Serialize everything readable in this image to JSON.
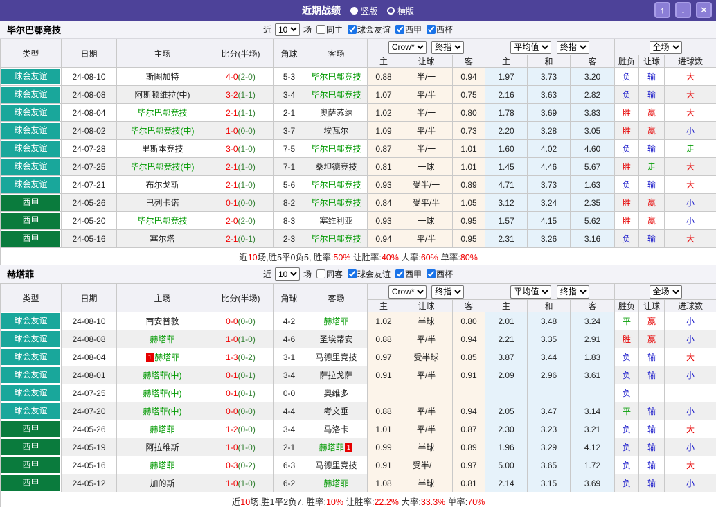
{
  "titlebar": {
    "title": "近期战绩",
    "radios": [
      {
        "label": "竖版",
        "selected": true
      },
      {
        "label": "横版",
        "selected": false
      }
    ],
    "buttons": {
      "up": "↑",
      "down": "↓",
      "close": "✕"
    }
  },
  "filter": {
    "prefix": "近",
    "matches": "10",
    "suffix": "场",
    "same_checked": false,
    "leagues": [
      "球会友谊",
      "西甲",
      "西杯"
    ],
    "leagues_checked": [
      true,
      true,
      true
    ]
  },
  "columns": [
    "类型",
    "日期",
    "主场",
    "比分(半场)",
    "角球",
    "客场"
  ],
  "subcolumns": [
    "主",
    "让球",
    "客",
    "主",
    "和",
    "客",
    "胜负",
    "让球",
    "进球数"
  ],
  "dropdowns": {
    "company": "Crow*",
    "company_stage": "终指",
    "avg": "平均值",
    "avg_stage": "终指",
    "scope": "全场"
  },
  "league_colors": {
    "球会友谊": "#19a79b",
    "西甲": "#0a7b3d"
  },
  "result_colors": {
    "胜": "#e60000",
    "赢": "#e60000",
    "大": "#e60000",
    "负": "#2222cc",
    "输": "#2222cc",
    "小": "#2222cc",
    "平": "#089e08",
    "走": "#089e08"
  },
  "sections": [
    {
      "team": "毕尔巴鄂竞技",
      "same_label": "同主",
      "rows": [
        {
          "league": "球会友谊",
          "date": "24-08-10",
          "home": {
            "name": "斯图加特",
            "green": false
          },
          "score": {
            "ft": "4-0",
            "ht": "(2-0)"
          },
          "corner": "5-3",
          "away": {
            "name": "毕尔巴鄂竞技",
            "green": true
          },
          "asian": [
            "0.88",
            "半/一",
            "0.94"
          ],
          "europe": [
            "1.97",
            "3.73",
            "3.20"
          ],
          "results": [
            "负",
            "输",
            "大"
          ]
        },
        {
          "league": "球会友谊",
          "date": "24-08-08",
          "home": {
            "name": "阿斯顿维拉(中)",
            "green": false
          },
          "score": {
            "ft": "3-2",
            "ht": "(1-1)"
          },
          "corner": "3-4",
          "away": {
            "name": "毕尔巴鄂竞技",
            "green": true
          },
          "asian": [
            "1.07",
            "平/半",
            "0.75"
          ],
          "europe": [
            "2.16",
            "3.63",
            "2.82"
          ],
          "results": [
            "负",
            "输",
            "大"
          ]
        },
        {
          "league": "球会友谊",
          "date": "24-08-04",
          "home": {
            "name": "毕尔巴鄂竞技",
            "green": true
          },
          "score": {
            "ft": "2-1",
            "ht": "(1-1)"
          },
          "corner": "2-1",
          "away": {
            "name": "奥萨苏纳",
            "green": false
          },
          "asian": [
            "1.02",
            "半/一",
            "0.80"
          ],
          "europe": [
            "1.78",
            "3.69",
            "3.83"
          ],
          "results": [
            "胜",
            "赢",
            "大"
          ]
        },
        {
          "league": "球会友谊",
          "date": "24-08-02",
          "home": {
            "name": "毕尔巴鄂竞技(中)",
            "green": true
          },
          "score": {
            "ft": "1-0",
            "ht": "(0-0)"
          },
          "corner": "3-7",
          "away": {
            "name": "埃瓦尔",
            "green": false
          },
          "asian": [
            "1.09",
            "平/半",
            "0.73"
          ],
          "europe": [
            "2.20",
            "3.28",
            "3.05"
          ],
          "results": [
            "胜",
            "赢",
            "小"
          ]
        },
        {
          "league": "球会友谊",
          "date": "24-07-28",
          "home": {
            "name": "里斯本竞技",
            "green": false
          },
          "score": {
            "ft": "3-0",
            "ht": "(1-0)"
          },
          "corner": "7-5",
          "away": {
            "name": "毕尔巴鄂竞技",
            "green": true
          },
          "asian": [
            "0.87",
            "半/一",
            "1.01"
          ],
          "europe": [
            "1.60",
            "4.02",
            "4.60"
          ],
          "results": [
            "负",
            "输",
            "走"
          ]
        },
        {
          "league": "球会友谊",
          "date": "24-07-25",
          "home": {
            "name": "毕尔巴鄂竞技(中)",
            "green": true
          },
          "score": {
            "ft": "2-1",
            "ht": "(1-0)"
          },
          "corner": "7-1",
          "away": {
            "name": "桑坦德竞技",
            "green": false
          },
          "asian": [
            "0.81",
            "一球",
            "1.01"
          ],
          "europe": [
            "1.45",
            "4.46",
            "5.67"
          ],
          "results": [
            "胜",
            "走",
            "大"
          ]
        },
        {
          "league": "球会友谊",
          "date": "24-07-21",
          "home": {
            "name": "布尔戈斯",
            "green": false
          },
          "score": {
            "ft": "2-1",
            "ht": "(1-0)"
          },
          "corner": "5-6",
          "away": {
            "name": "毕尔巴鄂竞技",
            "green": true
          },
          "asian": [
            "0.93",
            "受半/一",
            "0.89"
          ],
          "europe": [
            "4.71",
            "3.73",
            "1.63"
          ],
          "results": [
            "负",
            "输",
            "大"
          ]
        },
        {
          "league": "西甲",
          "date": "24-05-26",
          "home": {
            "name": "巴列卡诺",
            "green": false
          },
          "score": {
            "ft": "0-1",
            "ht": "(0-0)"
          },
          "corner": "8-2",
          "away": {
            "name": "毕尔巴鄂竞技",
            "green": true
          },
          "asian": [
            "0.84",
            "受平/半",
            "1.05"
          ],
          "europe": [
            "3.12",
            "3.24",
            "2.35"
          ],
          "results": [
            "胜",
            "赢",
            "小"
          ]
        },
        {
          "league": "西甲",
          "date": "24-05-20",
          "home": {
            "name": "毕尔巴鄂竞技",
            "green": true
          },
          "score": {
            "ft": "2-0",
            "ht": "(2-0)"
          },
          "corner": "8-3",
          "away": {
            "name": "塞维利亚",
            "green": false
          },
          "asian": [
            "0.93",
            "一球",
            "0.95"
          ],
          "europe": [
            "1.57",
            "4.15",
            "5.62"
          ],
          "results": [
            "胜",
            "赢",
            "小"
          ]
        },
        {
          "league": "西甲",
          "date": "24-05-16",
          "home": {
            "name": "塞尔塔",
            "green": false
          },
          "score": {
            "ft": "2-1",
            "ht": "(0-1)"
          },
          "corner": "2-3",
          "away": {
            "name": "毕尔巴鄂竞技",
            "green": true
          },
          "asian": [
            "0.94",
            "平/半",
            "0.95"
          ],
          "europe": [
            "2.31",
            "3.26",
            "3.16"
          ],
          "results": [
            "负",
            "输",
            "大"
          ]
        }
      ],
      "summary": [
        [
          "近",
          0
        ],
        [
          "10",
          1
        ],
        [
          "场,胜5平0负5, 胜率:",
          0
        ],
        [
          "50%",
          1
        ],
        [
          " 让胜率:",
          0
        ],
        [
          "40%",
          1
        ],
        [
          " 大率:",
          0
        ],
        [
          "60%",
          1
        ],
        [
          " 单率:",
          0
        ],
        [
          "80%",
          1
        ]
      ]
    },
    {
      "team": "赫塔菲",
      "same_label": "同客",
      "rows": [
        {
          "league": "球会友谊",
          "date": "24-08-10",
          "home": {
            "name": "南安普敦",
            "green": false
          },
          "score": {
            "ft": "0-0",
            "ht": "(0-0)"
          },
          "corner": "4-2",
          "away": {
            "name": "赫塔菲",
            "green": true
          },
          "asian": [
            "1.02",
            "半球",
            "0.80"
          ],
          "europe": [
            "2.01",
            "3.48",
            "3.24"
          ],
          "results": [
            "平",
            "赢",
            "小"
          ]
        },
        {
          "league": "球会友谊",
          "date": "24-08-08",
          "home": {
            "name": "赫塔菲",
            "green": true
          },
          "score": {
            "ft": "1-0",
            "ht": "(1-0)"
          },
          "corner": "4-6",
          "away": {
            "name": "圣埃蒂安",
            "green": false
          },
          "asian": [
            "0.88",
            "平/半",
            "0.94"
          ],
          "europe": [
            "2.21",
            "3.35",
            "2.91"
          ],
          "results": [
            "胜",
            "赢",
            "小"
          ]
        },
        {
          "league": "球会友谊",
          "date": "24-08-04",
          "home": {
            "name": "赫塔菲",
            "green": true,
            "card_before": "1"
          },
          "score": {
            "ft": "1-3",
            "ht": "(0-2)"
          },
          "corner": "3-1",
          "away": {
            "name": "马德里竞技",
            "green": false
          },
          "asian": [
            "0.97",
            "受半球",
            "0.85"
          ],
          "europe": [
            "3.87",
            "3.44",
            "1.83"
          ],
          "results": [
            "负",
            "输",
            "大"
          ]
        },
        {
          "league": "球会友谊",
          "date": "24-08-01",
          "home": {
            "name": "赫塔菲(中)",
            "green": true
          },
          "score": {
            "ft": "0-1",
            "ht": "(0-1)"
          },
          "corner": "3-4",
          "away": {
            "name": "萨拉戈萨",
            "green": false
          },
          "asian": [
            "0.91",
            "平/半",
            "0.91"
          ],
          "europe": [
            "2.09",
            "2.96",
            "3.61"
          ],
          "results": [
            "负",
            "输",
            "小"
          ]
        },
        {
          "league": "球会友谊",
          "date": "24-07-25",
          "home": {
            "name": "赫塔菲(中)",
            "green": true
          },
          "score": {
            "ft": "0-1",
            "ht": "(0-1)"
          },
          "corner": "0-0",
          "away": {
            "name": "奥维多",
            "green": false
          },
          "asian": [
            "",
            "",
            ""
          ],
          "europe": [
            "",
            "",
            ""
          ],
          "results": [
            "负",
            "",
            ""
          ]
        },
        {
          "league": "球会友谊",
          "date": "24-07-20",
          "home": {
            "name": "赫塔菲(中)",
            "green": true
          },
          "score": {
            "ft": "0-0",
            "ht": "(0-0)"
          },
          "corner": "4-4",
          "away": {
            "name": "考文垂",
            "green": false
          },
          "asian": [
            "0.88",
            "平/半",
            "0.94"
          ],
          "europe": [
            "2.05",
            "3.47",
            "3.14"
          ],
          "results": [
            "平",
            "输",
            "小"
          ]
        },
        {
          "league": "西甲",
          "date": "24-05-26",
          "home": {
            "name": "赫塔菲",
            "green": true
          },
          "score": {
            "ft": "1-2",
            "ht": "(0-0)"
          },
          "corner": "3-4",
          "away": {
            "name": "马洛卡",
            "green": false
          },
          "asian": [
            "1.01",
            "平/半",
            "0.87"
          ],
          "europe": [
            "2.30",
            "3.23",
            "3.21"
          ],
          "results": [
            "负",
            "输",
            "大"
          ]
        },
        {
          "league": "西甲",
          "date": "24-05-19",
          "home": {
            "name": "阿拉维斯",
            "green": false
          },
          "score": {
            "ft": "1-0",
            "ht": "(1-0)"
          },
          "corner": "2-1",
          "away": {
            "name": "赫塔菲",
            "green": true,
            "card_after": "1"
          },
          "asian": [
            "0.99",
            "半球",
            "0.89"
          ],
          "europe": [
            "1.96",
            "3.29",
            "4.12"
          ],
          "results": [
            "负",
            "输",
            "小"
          ]
        },
        {
          "league": "西甲",
          "date": "24-05-16",
          "home": {
            "name": "赫塔菲",
            "green": true
          },
          "score": {
            "ft": "0-3",
            "ht": "(0-2)"
          },
          "corner": "6-3",
          "away": {
            "name": "马德里竞技",
            "green": false
          },
          "asian": [
            "0.91",
            "受半/一",
            "0.97"
          ],
          "europe": [
            "5.00",
            "3.65",
            "1.72"
          ],
          "results": [
            "负",
            "输",
            "大"
          ]
        },
        {
          "league": "西甲",
          "date": "24-05-12",
          "home": {
            "name": "加的斯",
            "green": false
          },
          "score": {
            "ft": "1-0",
            "ht": "(1-0)"
          },
          "corner": "6-2",
          "away": {
            "name": "赫塔菲",
            "green": true
          },
          "asian": [
            "1.08",
            "半球",
            "0.81"
          ],
          "europe": [
            "2.14",
            "3.15",
            "3.69"
          ],
          "results": [
            "负",
            "输",
            "小"
          ]
        }
      ],
      "summary": [
        [
          "近",
          0
        ],
        [
          "10",
          1
        ],
        [
          "场,胜1平2负7, 胜率:",
          0
        ],
        [
          "10%",
          1
        ],
        [
          " 让胜率:",
          0
        ],
        [
          "22.2%",
          1
        ],
        [
          " 大率:",
          0
        ],
        [
          "33.3%",
          1
        ],
        [
          " 单率:",
          0
        ],
        [
          "70%",
          1
        ]
      ]
    }
  ]
}
